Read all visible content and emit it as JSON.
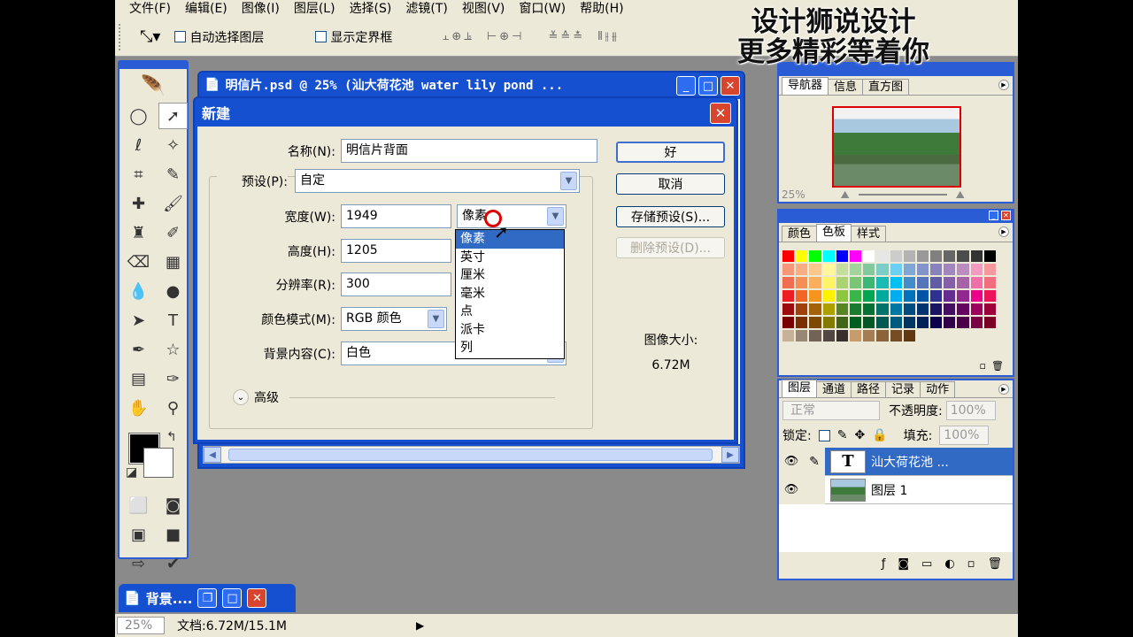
{
  "menubar": {
    "items": [
      "文件(F)",
      "编辑(E)",
      "图像(I)",
      "图层(L)",
      "选择(S)",
      "滤镜(T)",
      "视图(V)",
      "窗口(W)",
      "帮助(H)"
    ]
  },
  "options": {
    "auto_select": "自动选择图层",
    "show_bounds": "显示定界框"
  },
  "watermark": {
    "line1": "设计狮说设计",
    "line2": "更多精彩等着你"
  },
  "document": {
    "title": "明信片.psd @ 25% (汕大荷花池  water lily pond ..."
  },
  "dialog": {
    "title": "新建",
    "name_label": "名称(N):",
    "name_value": "明信片背面",
    "preset_label": "预设(P):",
    "preset_value": "自定",
    "width_label": "宽度(W):",
    "width_value": "1949",
    "height_label": "高度(H):",
    "height_value": "1205",
    "resolution_label": "分辨率(R):",
    "resolution_value": "300",
    "colormode_label": "颜色模式(M):",
    "colormode_value": "RGB 颜色",
    "background_label": "背景内容(C):",
    "background_value": "白色",
    "unit_value": "像素",
    "advanced_label": "高级",
    "ok_label": "好",
    "cancel_label": "取消",
    "save_preset_label": "存储预设(S)...",
    "delete_preset_label": "删除预设(D)...",
    "image_size_label": "图像大小:",
    "image_size_value": "6.72M",
    "unit_options": [
      "像素",
      "英寸",
      "厘米",
      "毫米",
      "点",
      "派卡",
      "列"
    ]
  },
  "navigator": {
    "tabs": [
      "导航器",
      "信息",
      "直方图"
    ],
    "zoom": "25%"
  },
  "swatches": {
    "tabs": [
      "颜色",
      "色板",
      "样式"
    ],
    "colors": [
      "#ff0000",
      "#ffff00",
      "#00ff00",
      "#00ffff",
      "#0000ff",
      "#ff00ff",
      "#ffffff",
      "#e6e6e6",
      "#cccccc",
      "#b3b3b3",
      "#999999",
      "#808080",
      "#666666",
      "#4d4d4d",
      "#333333",
      "#000000",
      "#f7977a",
      "#f9ad81",
      "#fdc68a",
      "#fff79a",
      "#c4df9b",
      "#a3d39c",
      "#82ca9d",
      "#7bcdc8",
      "#6ecff6",
      "#7ea7d8",
      "#8493ca",
      "#8882be",
      "#a187be",
      "#bc8dbf",
      "#f49ac2",
      "#f6989d",
      "#f26c4f",
      "#f68e55",
      "#fbaf5c",
      "#fff467",
      "#acd372",
      "#7cc576",
      "#3bb878",
      "#1abbb4",
      "#00bff3",
      "#438cca",
      "#5574b9",
      "#605ca8",
      "#855fa8",
      "#a763a8",
      "#f06ea9",
      "#f26d7d",
      "#ed1c24",
      "#f26522",
      "#f7941d",
      "#fff200",
      "#8dc73f",
      "#39b54a",
      "#00a651",
      "#00a99d",
      "#00aeef",
      "#0072bc",
      "#0054a6",
      "#2e3192",
      "#662d91",
      "#92278f",
      "#ec008c",
      "#ed145b",
      "#9e0b0f",
      "#a0410d",
      "#a36209",
      "#aba000",
      "#598527",
      "#1a7b30",
      "#007236",
      "#00746b",
      "#0076a3",
      "#004b80",
      "#003471",
      "#1b1464",
      "#440e62",
      "#630460",
      "#9e005d",
      "#9e0039",
      "#790000",
      "#7b2e00",
      "#7d4900",
      "#827b00",
      "#406618",
      "#005e20",
      "#005826",
      "#005952",
      "#005b7f",
      "#003663",
      "#002157",
      "#0d004c",
      "#32004b",
      "#4b0049",
      "#7b0046",
      "#7a0026",
      "#c7b299",
      "#998675",
      "#736357",
      "#534741",
      "#37302d",
      "#c69c6d",
      "#a67c52",
      "#8c6239",
      "#754c24",
      "#603913"
    ]
  },
  "layers": {
    "tabs": [
      "图层",
      "通道",
      "路径",
      "记录",
      "动作"
    ],
    "blend_mode": "正常",
    "opacity_label": "不透明度:",
    "opacity_value": "100%",
    "lock_label": "锁定:",
    "fill_label": "填充:",
    "fill_value": "100%",
    "items": [
      {
        "name": "汕大荷花池 ...",
        "thumb": "T"
      },
      {
        "name": "图层 1",
        "thumb": ""
      }
    ]
  },
  "minimized": {
    "title": "背景...."
  },
  "statusbar": {
    "zoom": "25%",
    "doc_info": "文档:6.72M/15.1M"
  }
}
